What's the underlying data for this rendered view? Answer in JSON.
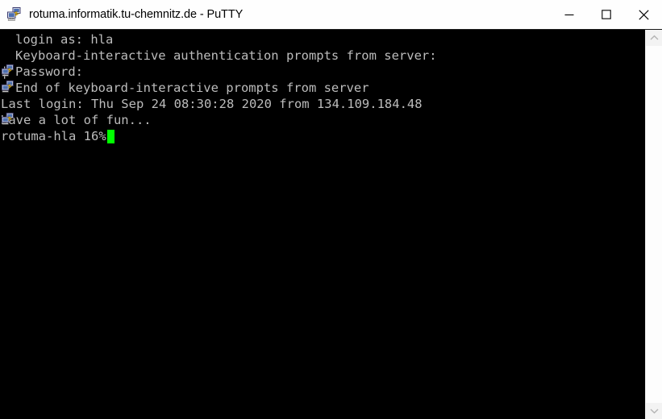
{
  "window": {
    "title": "rotuma.informatik.tu-chemnitz.de - PuTTY",
    "app_icon": "putty-icon",
    "titlebar_bg": "#fefefe",
    "titlebar_text_color": "#000000"
  },
  "controls": {
    "minimize_label": "Minimize",
    "minimize_icon": "minimize-icon",
    "maximize_label": "Maximize",
    "maximize_icon": "maximize-icon",
    "close_label": "Close",
    "close_icon": "close-icon"
  },
  "terminal": {
    "background": "#000000",
    "foreground": "#bcbcbc",
    "cursor_color": "#00ff00",
    "lines": [
      {
        "glyph": "putty-icon",
        "text": "login as: hla"
      },
      {
        "glyph": "putty-icon",
        "text": "Keyboard-interactive authentication prompts from server:"
      },
      {
        "glyph": "pipe",
        "text": "Password:"
      },
      {
        "glyph": "putty-icon",
        "text": "End of keyboard-interactive prompts from server"
      },
      {
        "glyph": "none",
        "text": "Last login: Thu Sep 24 08:30:28 2020 from 134.109.184.48"
      },
      {
        "glyph": "none",
        "text": "Have a lot of fun..."
      }
    ],
    "prompt": "rotuma-hla 16%",
    "pipe_char": "|"
  },
  "scrollbar": {
    "up_label": "Scroll up",
    "up_icon": "chevron-up-icon",
    "down_label": "Scroll down",
    "down_icon": "chevron-down-icon",
    "track_color": "#fdfdfd"
  }
}
